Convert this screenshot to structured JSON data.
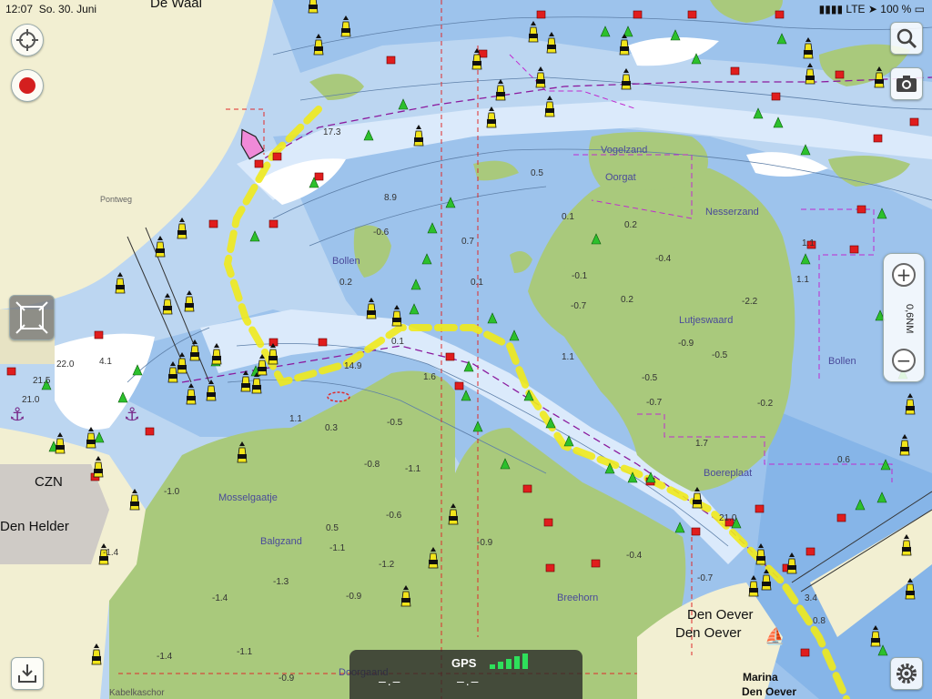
{
  "status_bar": {
    "time": "12:07",
    "date": "So. 30. Juni",
    "network": "LTE",
    "battery": "100 %"
  },
  "map": {
    "place_labels": [
      "De Waal",
      "Den Helder",
      "Den Oever",
      "Den Oever",
      "Marina",
      "Den Oever",
      "CZN",
      "Vogelzand",
      "Oorgat",
      "Nesserzand",
      "Bollen",
      "Lutjeswaard",
      "Bollen",
      "Boereplaat",
      "Mosselgaatje",
      "Balgzand",
      "Breehorn",
      "Pontweg",
      "Kabelkaschor",
      "Doorgaand"
    ],
    "depth_labels": [
      "17.3",
      "8.9",
      "0.5",
      "0.1",
      "0.2",
      "0.7",
      "-0.6",
      "0.2",
      "0.1",
      "-0.1",
      "-0.7",
      "0.2",
      "1.1",
      "-0.4",
      "-2.2",
      "-0.9",
      "-0.5",
      "-0.5",
      "-0.7",
      "-0.2",
      "1.7",
      "0.6",
      "1.1",
      "0.1",
      "14.9",
      "1.6",
      "1.1",
      "0.3",
      "-0.5",
      "-0.8",
      "-1.1",
      "-0.6",
      "-1.0",
      "-1.4",
      "0.5",
      "-1.1",
      "-1.2",
      "-1.3",
      "-0.9",
      "-1.4",
      "-1.4",
      "-1.1",
      "-0.9",
      "-0.9",
      "-0.4",
      "-0.7",
      "21.0",
      "22.0",
      "21.5",
      "21.0",
      "4.1",
      "3.4",
      "0.8",
      "1.1"
    ],
    "colors": {
      "deep_water": "#bcd6f1",
      "mid_water": "#9dc3ec",
      "shallow": "#7fb0e5",
      "drying": "#a9c97c",
      "land": "#f2efd2",
      "route": "#f0ea1c"
    }
  },
  "controls": {
    "locate_icon": "crosshair-icon",
    "record_icon": "record-icon",
    "search_icon": "search-icon",
    "camera_icon": "camera-icon",
    "settings_icon": "gear-icon",
    "import_icon": "download-tray-icon",
    "zoom_in": "+",
    "zoom_out": "−",
    "scale": "0,6NM"
  },
  "gps_panel": {
    "label": "GPS",
    "speed": "–.–",
    "course": "–.–",
    "signal_bars": 5
  }
}
